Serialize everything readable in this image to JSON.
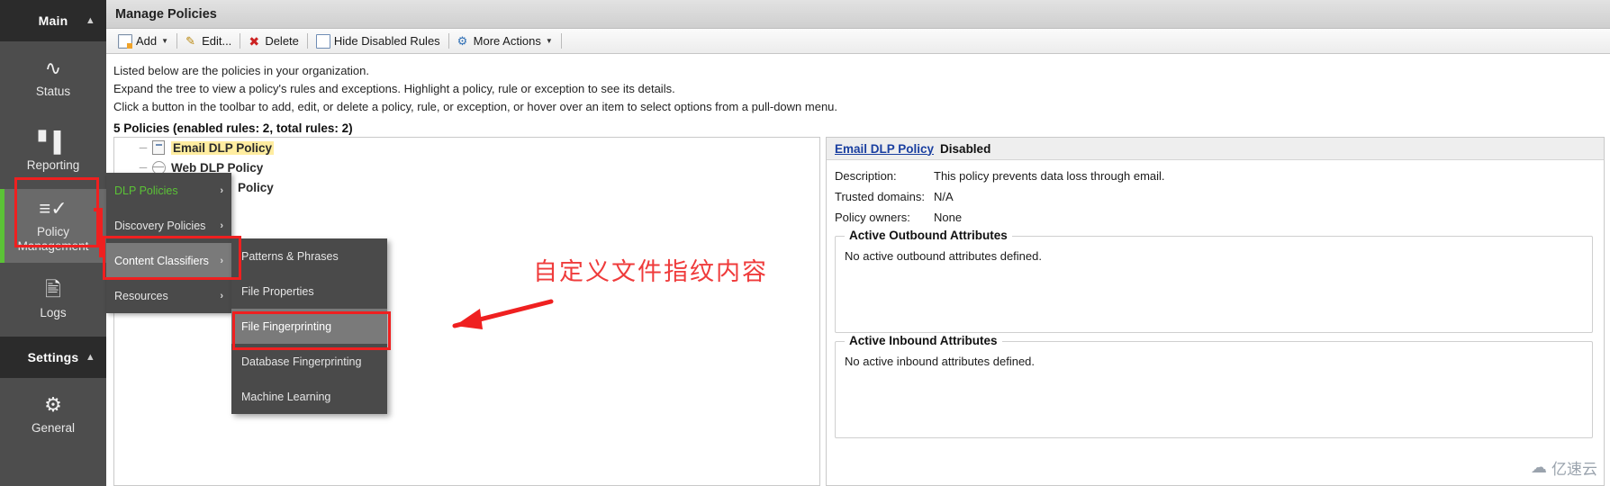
{
  "left_nav": {
    "sections": [
      {
        "label": "Main",
        "caret": "chevron-up-icon",
        "items": [
          {
            "label": "Status",
            "icon": "pulse-icon",
            "active": false
          },
          {
            "label": "Reporting",
            "icon": "bar-chart-icon",
            "active": false
          },
          {
            "label": "Policy Management",
            "icon": "checklist-icon",
            "active": true
          },
          {
            "label": "Logs",
            "icon": "document-edit-icon",
            "active": false
          }
        ]
      },
      {
        "label": "Settings",
        "caret": "chevron-up-icon",
        "items": [
          {
            "label": "General",
            "icon": "gear-icon",
            "active": false
          }
        ]
      }
    ]
  },
  "titlebar": {
    "title": "Manage Policies"
  },
  "toolbar": {
    "buttons": [
      {
        "label": "Add",
        "icon": "add-page-icon",
        "has_caret": true
      },
      {
        "label": "Edit...",
        "icon": "pencil-icon",
        "has_caret": false
      },
      {
        "label": "Delete",
        "icon": "red-x-icon",
        "has_caret": false
      },
      {
        "label": "Hide Disabled Rules",
        "icon": "blank-square-icon",
        "has_caret": false
      },
      {
        "label": "More Actions",
        "icon": "more-actions-icon",
        "has_caret": true
      }
    ]
  },
  "description": {
    "line1": "Listed below are the policies in your organization.",
    "line2": "Expand the tree to view a policy's rules and exceptions. Highlight a policy, rule or exception to see its details.",
    "line3": "Click a button in the toolbar to add, edit, or delete a policy, rule, or exception, or hover over an item to select options from a pull-down menu."
  },
  "count_line": "5 Policies (enabled rules: 2, total rules: 2)",
  "tree": {
    "rows": [
      {
        "label": "Email DLP Policy",
        "icon": "policy-doc-icon",
        "selected": true
      },
      {
        "label": "Web DLP Policy",
        "icon": "policy-globe-icon",
        "selected": false
      },
      {
        "label": "Policy",
        "icon": "",
        "selected": false
      }
    ]
  },
  "context_menu": {
    "items": [
      {
        "label": "DLP Policies",
        "arrow": "chevron-right-icon",
        "state": "current"
      },
      {
        "label": "Discovery Policies",
        "arrow": "chevron-right-icon",
        "state": "normal"
      },
      {
        "label": "Content Classifiers",
        "arrow": "chevron-right-icon",
        "state": "highlighted"
      },
      {
        "label": "Resources",
        "arrow": "chevron-right-icon",
        "state": "normal"
      }
    ]
  },
  "submenu": {
    "items": [
      {
        "label": "Patterns & Phrases",
        "state": "normal"
      },
      {
        "label": "File Properties",
        "state": "normal"
      },
      {
        "label": "File Fingerprinting",
        "state": "highlighted"
      },
      {
        "label": "Database Fingerprinting",
        "state": "normal"
      },
      {
        "label": "Machine Learning",
        "state": "normal"
      }
    ]
  },
  "detail_panel": {
    "policy_link": "Email DLP Policy",
    "status": "Disabled",
    "fields": [
      {
        "key": "Description:",
        "value": "This policy prevents data loss through email."
      },
      {
        "key": "Trusted domains:",
        "value": "N/A"
      },
      {
        "key": "Policy owners:",
        "value": "None"
      }
    ],
    "outbound": {
      "legend": "Active Outbound Attributes",
      "body": "No active outbound attributes defined."
    },
    "inbound": {
      "legend": "Active Inbound Attributes",
      "body": "No active inbound attributes defined."
    }
  },
  "annotation": {
    "text": "自定义文件指纹内容",
    "color": "#ef3b3b"
  },
  "watermark": {
    "text": "亿速云",
    "icon": "cloud-icon"
  },
  "colors": {
    "accent_green": "#5bc236",
    "highlight_red": "#ef2020",
    "nav_dark": "#4d4d4d",
    "nav_header": "#2b2b2b",
    "link_blue": "#1a3fa0"
  }
}
